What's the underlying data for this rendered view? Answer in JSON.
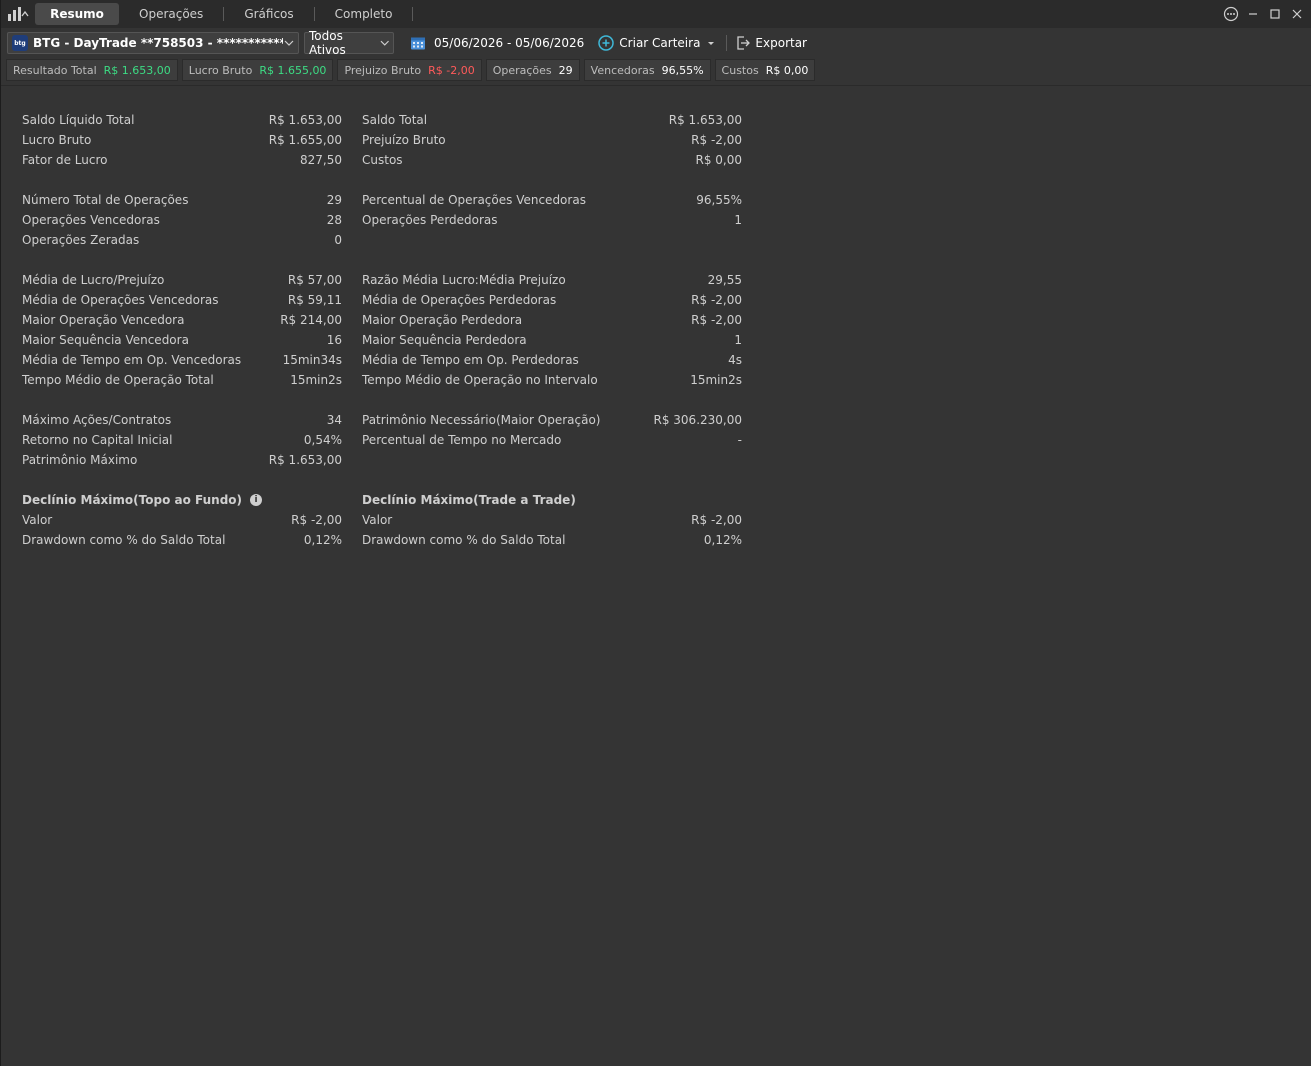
{
  "tabs": [
    {
      "label": "Resumo",
      "active": true
    },
    {
      "label": "Operações",
      "active": false
    },
    {
      "label": "Gráficos",
      "active": false
    },
    {
      "label": "Completo",
      "active": false
    }
  ],
  "toolbar": {
    "account": "BTG - DayTrade **758503 - ****************...",
    "assets": "Todos Ativos",
    "date_range": "05/06/2026 - 05/06/2026",
    "create_portfolio": "Criar Carteira",
    "export": "Exportar"
  },
  "chips": [
    {
      "label": "Resultado Total",
      "value": "R$ 1.653,00",
      "tone": "green"
    },
    {
      "label": "Lucro Bruto",
      "value": "R$ 1.655,00",
      "tone": "green"
    },
    {
      "label": "Prejuizo Bruto",
      "value": "R$ -2,00",
      "tone": "red"
    },
    {
      "label": "Operações",
      "value": "29",
      "tone": "white"
    },
    {
      "label": "Vencedoras",
      "value": "96,55%",
      "tone": "white"
    },
    {
      "label": "Custos",
      "value": "R$ 0,00",
      "tone": "white"
    }
  ],
  "left": [
    {
      "label": "Saldo Líquido Total",
      "value": "R$ 1.653,00",
      "tone": "green"
    },
    {
      "label": "Lucro Bruto",
      "value": "R$ 1.655,00",
      "tone": "green"
    },
    {
      "label": "Fator de Lucro",
      "value": "827,50",
      "tone": ""
    },
    null,
    {
      "label": "Número Total de Operações",
      "value": "29",
      "tone": ""
    },
    {
      "label": "Operações Vencedoras",
      "value": "28",
      "tone": ""
    },
    {
      "label": "Operações Zeradas",
      "value": "0",
      "tone": ""
    },
    null,
    {
      "label": "Média de Lucro/Prejuízo",
      "value": "R$ 57,00",
      "tone": "green"
    },
    {
      "label": "Média de Operações Vencedoras",
      "value": "R$ 59,11",
      "tone": "green"
    },
    {
      "label": "Maior Operação Vencedora",
      "value": "R$ 214,00",
      "tone": "green"
    },
    {
      "label": "Maior Sequência Vencedora",
      "value": "16",
      "tone": ""
    },
    {
      "label": "Média de Tempo em Op. Vencedoras",
      "value": "15min34s",
      "tone": ""
    },
    {
      "label": "Tempo Médio de Operação Total",
      "value": "15min2s",
      "tone": ""
    },
    null,
    {
      "label": "Máximo Ações/Contratos",
      "value": "34",
      "tone": ""
    },
    {
      "label": "Retorno no Capital Inicial",
      "value": "0,54%",
      "tone": ""
    },
    {
      "label": "Patrimônio Máximo",
      "value": "R$ 1.653,00",
      "tone": ""
    },
    null,
    {
      "label": "Declínio Máximo(Topo ao Fundo)",
      "value": "",
      "tone": "",
      "header": true,
      "info": true
    },
    {
      "label": "Valor",
      "value": "R$ -2,00",
      "tone": "red"
    },
    {
      "label": "Drawdown como % do Saldo Total",
      "value": "0,12%",
      "tone": ""
    }
  ],
  "right": [
    {
      "label": "Saldo Total",
      "value": "R$ 1.653,00",
      "tone": "green"
    },
    {
      "label": "Prejuízo Bruto",
      "value": "R$ -2,00",
      "tone": "red"
    },
    {
      "label": "Custos",
      "value": "R$ 0,00",
      "tone": "red"
    },
    null,
    {
      "label": "Percentual de Operações Vencedoras",
      "value": "96,55%",
      "tone": ""
    },
    {
      "label": "Operações Perdedoras",
      "value": "1",
      "tone": ""
    },
    null,
    null,
    {
      "label": "Razão Média Lucro:Média Prejuízo",
      "value": "29,55",
      "tone": ""
    },
    {
      "label": "Média de Operações Perdedoras",
      "value": "R$ -2,00",
      "tone": "red"
    },
    {
      "label": "Maior Operação Perdedora",
      "value": "R$ -2,00",
      "tone": "red"
    },
    {
      "label": "Maior Sequência Perdedora",
      "value": "1",
      "tone": ""
    },
    {
      "label": "Média de Tempo em Op. Perdedoras",
      "value": "4s",
      "tone": ""
    },
    {
      "label": "Tempo Médio de Operação no Intervalo",
      "value": "15min2s",
      "tone": ""
    },
    null,
    {
      "label": "Patrimônio Necessário(Maior Operação)",
      "value": "R$ 306.230,00",
      "tone": ""
    },
    {
      "label": "Percentual de Tempo no Mercado",
      "value": "-",
      "tone": ""
    },
    null,
    null,
    {
      "label": "Declínio Máximo(Trade a Trade)",
      "value": "",
      "tone": "",
      "header": true
    },
    {
      "label": "Valor",
      "value": "R$ -2,00",
      "tone": "red"
    },
    {
      "label": "Drawdown como % do Saldo Total",
      "value": "0,12%",
      "tone": ""
    }
  ]
}
